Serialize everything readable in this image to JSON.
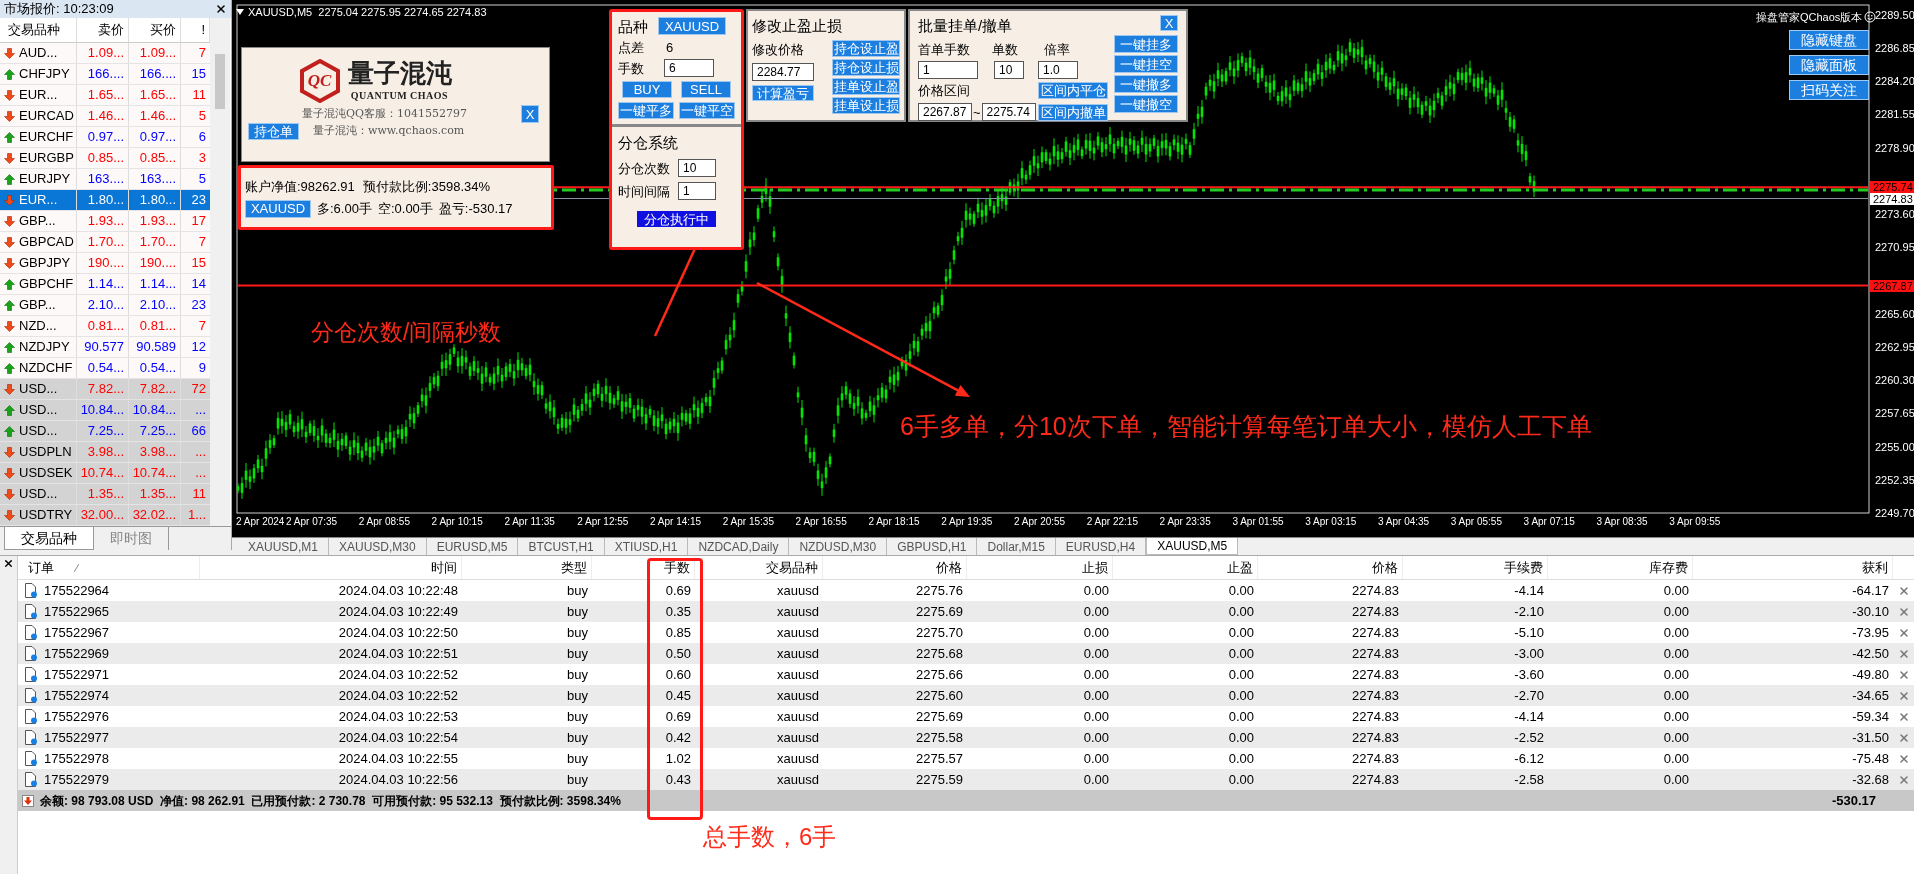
{
  "market_watch": {
    "title": "市场报价: 10:23:09",
    "columns": [
      "交易品种",
      "卖价",
      "买价",
      "!"
    ],
    "rows": [
      {
        "symbol": "AUD...",
        "bid": "1.09...",
        "ask": "1.09...",
        "spread": "7",
        "rising": false,
        "selected": false,
        "shaded": false
      },
      {
        "symbol": "CHFJPY",
        "bid": "166....",
        "ask": "166....",
        "spread": "15",
        "rising": true,
        "selected": false,
        "shaded": false
      },
      {
        "symbol": "EUR...",
        "bid": "1.65...",
        "ask": "1.65...",
        "spread": "11",
        "rising": false,
        "selected": false,
        "shaded": false
      },
      {
        "symbol": "EURCAD",
        "bid": "1.46...",
        "ask": "1.46...",
        "spread": "5",
        "rising": false,
        "selected": false,
        "shaded": false
      },
      {
        "symbol": "EURCHF",
        "bid": "0.97...",
        "ask": "0.97...",
        "spread": "6",
        "rising": true,
        "selected": false,
        "shaded": false
      },
      {
        "symbol": "EURGBP",
        "bid": "0.85...",
        "ask": "0.85...",
        "spread": "3",
        "rising": false,
        "selected": false,
        "shaded": false
      },
      {
        "symbol": "EURJPY",
        "bid": "163....",
        "ask": "163....",
        "spread": "5",
        "rising": true,
        "selected": false,
        "shaded": false
      },
      {
        "symbol": "EUR...",
        "bid": "1.80...",
        "ask": "1.80...",
        "spread": "23",
        "rising": false,
        "selected": true,
        "shaded": false
      },
      {
        "symbol": "GBP...",
        "bid": "1.93...",
        "ask": "1.93...",
        "spread": "17",
        "rising": false,
        "selected": false,
        "shaded": false
      },
      {
        "symbol": "GBPCAD",
        "bid": "1.70...",
        "ask": "1.70...",
        "spread": "7",
        "rising": false,
        "selected": false,
        "shaded": false
      },
      {
        "symbol": "GBPJPY",
        "bid": "190....",
        "ask": "190....",
        "spread": "15",
        "rising": false,
        "selected": false,
        "shaded": false
      },
      {
        "symbol": "GBPCHF",
        "bid": "1.14...",
        "ask": "1.14...",
        "spread": "14",
        "rising": true,
        "selected": false,
        "shaded": false
      },
      {
        "symbol": "GBP...",
        "bid": "2.10...",
        "ask": "2.10...",
        "spread": "23",
        "rising": true,
        "selected": false,
        "shaded": false
      },
      {
        "symbol": "NZD...",
        "bid": "0.81...",
        "ask": "0.81...",
        "spread": "7",
        "rising": false,
        "selected": false,
        "shaded": false
      },
      {
        "symbol": "NZDJPY",
        "bid": "90.577",
        "ask": "90.589",
        "spread": "12",
        "rising": true,
        "selected": false,
        "shaded": false
      },
      {
        "symbol": "NZDCHF",
        "bid": "0.54...",
        "ask": "0.54...",
        "spread": "9",
        "rising": true,
        "selected": false,
        "shaded": false
      },
      {
        "symbol": "USD...",
        "bid": "7.82...",
        "ask": "7.82...",
        "spread": "72",
        "rising": false,
        "selected": false,
        "shaded": true
      },
      {
        "symbol": "USD...",
        "bid": "10.84...",
        "ask": "10.84...",
        "spread": "...",
        "rising": true,
        "selected": false,
        "shaded": true
      },
      {
        "symbol": "USD...",
        "bid": "7.25...",
        "ask": "7.25...",
        "spread": "66",
        "rising": true,
        "selected": false,
        "shaded": true
      },
      {
        "symbol": "USDPLN",
        "bid": "3.98...",
        "ask": "3.98...",
        "spread": "...",
        "rising": false,
        "selected": false,
        "shaded": true
      },
      {
        "symbol": "USDSEK",
        "bid": "10.74...",
        "ask": "10.74...",
        "spread": "...",
        "rising": false,
        "selected": false,
        "shaded": true
      },
      {
        "symbol": "USD...",
        "bid": "1.35...",
        "ask": "1.35...",
        "spread": "11",
        "rising": false,
        "selected": false,
        "shaded": true
      },
      {
        "symbol": "USDTRY",
        "bid": "32.00...",
        "ask": "32.02...",
        "spread": "1...",
        "rising": false,
        "selected": false,
        "shaded": true
      }
    ],
    "tabs": [
      {
        "label": "交易品种",
        "selected": true
      },
      {
        "label": "即时图",
        "selected": false
      }
    ]
  },
  "chart": {
    "header": "XAUUSD,M5  2275.04 2275.95 2274.65 2274.83",
    "price_ticks": [
      "2289.50",
      "2286.85",
      "2284.20",
      "2281.55",
      "2278.90",
      "2273.60",
      "2270.95",
      "2265.60",
      "2262.95",
      "2260.30",
      "2257.65",
      "2255.00",
      "2252.35",
      "2249.70"
    ],
    "price_tags": [
      {
        "value": "2275.74",
        "kind": "line"
      },
      {
        "value": "2274.83",
        "kind": "current"
      },
      {
        "value": "2267.87",
        "kind": "line"
      }
    ],
    "time_ticks": [
      "2 Apr 2024",
      "2 Apr 07:35",
      "2 Apr 08:55",
      "2 Apr 10:15",
      "2 Apr 11:35",
      "2 Apr 12:55",
      "2 Apr 14:15",
      "2 Apr 15:35",
      "2 Apr 16:55",
      "2 Apr 18:15",
      "2 Apr 19:35",
      "2 Apr 20:55",
      "2 Apr 22:15",
      "2 Apr 23:35",
      "3 Apr 01:55",
      "3 Apr 03:15",
      "3 Apr 04:35",
      "3 Apr 05:55",
      "3 Apr 07:15",
      "3 Apr 08:35",
      "3 Apr 09:55"
    ],
    "version_label": "操盘管家QChaos版本",
    "side_buttons": [
      "隐藏键盘",
      "隐藏面板",
      "扫码关注"
    ],
    "annotations": [
      "分仓次数/间隔秒数",
      "6手多单，分10次下单，智能计算每笔订单大小，模仿人工下单"
    ]
  },
  "logo_panel": {
    "logo_mark": "QC",
    "brand": "量子混沌",
    "brand_en": "QUANTUM CHAOS",
    "support": "量子混沌QQ客服：1041552797",
    "site": "量子混沌：www.qchaos.com",
    "close": "X",
    "positions_button": "持仓单"
  },
  "account_panel": {
    "equity": "账户净值:98262.91",
    "margin_level": "预付款比例:3598.34%",
    "symbol": "XAUUSD",
    "long": "多:6.00手",
    "short": "空:0.00手",
    "pnl": "盈亏:-530.17"
  },
  "trade_panel": {
    "symbol_label": "品种",
    "symbol": "XAUUSD",
    "spread_label": "点差",
    "spread": "6",
    "lots_label": "手数",
    "lots": "6",
    "buy": "BUY",
    "sell": "SELL",
    "close_long": "一键平多",
    "close_short": "一键平空"
  },
  "split_panel": {
    "title": "分仓系统",
    "count_label": "分仓次数",
    "count": "10",
    "interval_label": "时间间隔",
    "interval": "1",
    "run": "分仓执行中"
  },
  "sltp_panel": {
    "title": "修改止盈止损",
    "price_label": "修改价格",
    "price": "2284.77",
    "calc": "计算盈亏",
    "buttons": [
      "持仓设止盈",
      "持仓设止损",
      "挂单设止盈",
      "挂单设止损"
    ]
  },
  "batch_panel": {
    "title": "批量挂单/撤单",
    "close": "X",
    "first_lots_label": "首单手数",
    "count_label": "单数",
    "multiplier_label": "倍率",
    "first_lots": "1",
    "count": "10",
    "multiplier": "1.0",
    "range_label": "价格区间",
    "range_low": "2267.87",
    "range_sep": "~",
    "range_high": "2275.74",
    "range_buttons": [
      "区间内平仓",
      "区间内撤单"
    ],
    "side_buttons": [
      "一键挂多",
      "一键挂空",
      "一键撤多",
      "一键撤空"
    ]
  },
  "chart_tabs": [
    {
      "label": "XAUUSD,M1",
      "selected": false
    },
    {
      "label": "XAUUSD,M30",
      "selected": false
    },
    {
      "label": "EURUSD,M5",
      "selected": false
    },
    {
      "label": "BTCUST,H1",
      "selected": false
    },
    {
      "label": "XTIUSD,H1",
      "selected": false
    },
    {
      "label": "NZDCAD,Daily",
      "selected": false
    },
    {
      "label": "NZDUSD,M30",
      "selected": false
    },
    {
      "label": "GBPUSD,H1",
      "selected": false
    },
    {
      "label": "Dollar,M15",
      "selected": false
    },
    {
      "label": "EURUSD,H4",
      "selected": false
    },
    {
      "label": "XAUUSD,M5",
      "selected": true
    }
  ],
  "orders": {
    "columns": [
      "订单",
      "时间",
      "类型",
      "手数",
      "交易品种",
      "价格",
      "止损",
      "止盈",
      "价格",
      "手续费",
      "库存费",
      "获利"
    ],
    "rows": [
      [
        "175522964",
        "2024.04.03 10:22:48",
        "buy",
        "0.69",
        "xauusd",
        "2275.76",
        "0.00",
        "0.00",
        "2274.83",
        "-4.14",
        "0.00",
        "-64.17"
      ],
      [
        "175522965",
        "2024.04.03 10:22:49",
        "buy",
        "0.35",
        "xauusd",
        "2275.69",
        "0.00",
        "0.00",
        "2274.83",
        "-2.10",
        "0.00",
        "-30.10"
      ],
      [
        "175522967",
        "2024.04.03 10:22:50",
        "buy",
        "0.85",
        "xauusd",
        "2275.70",
        "0.00",
        "0.00",
        "2274.83",
        "-5.10",
        "0.00",
        "-73.95"
      ],
      [
        "175522969",
        "2024.04.03 10:22:51",
        "buy",
        "0.50",
        "xauusd",
        "2275.68",
        "0.00",
        "0.00",
        "2274.83",
        "-3.00",
        "0.00",
        "-42.50"
      ],
      [
        "175522971",
        "2024.04.03 10:22:52",
        "buy",
        "0.60",
        "xauusd",
        "2275.66",
        "0.00",
        "0.00",
        "2274.83",
        "-3.60",
        "0.00",
        "-49.80"
      ],
      [
        "175522974",
        "2024.04.03 10:22:52",
        "buy",
        "0.45",
        "xauusd",
        "2275.60",
        "0.00",
        "0.00",
        "2274.83",
        "-2.70",
        "0.00",
        "-34.65"
      ],
      [
        "175522976",
        "2024.04.03 10:22:53",
        "buy",
        "0.69",
        "xauusd",
        "2275.69",
        "0.00",
        "0.00",
        "2274.83",
        "-4.14",
        "0.00",
        "-59.34"
      ],
      [
        "175522977",
        "2024.04.03 10:22:54",
        "buy",
        "0.42",
        "xauusd",
        "2275.58",
        "0.00",
        "0.00",
        "2274.83",
        "-2.52",
        "0.00",
        "-31.50"
      ],
      [
        "175522978",
        "2024.04.03 10:22:55",
        "buy",
        "1.02",
        "xauusd",
        "2275.57",
        "0.00",
        "0.00",
        "2274.83",
        "-6.12",
        "0.00",
        "-75.48"
      ],
      [
        "175522979",
        "2024.04.03 10:22:56",
        "buy",
        "0.43",
        "xauusd",
        "2275.59",
        "0.00",
        "0.00",
        "2274.83",
        "-2.58",
        "0.00",
        "-32.68"
      ]
    ],
    "summary": "余额: 98 793.08 USD  净值: 98 262.91  已用预付款: 2 730.78  可用预付款: 95 532.13  预付款比例: 3598.34%",
    "summary_profit": "-530.17",
    "note": "总手数，6手"
  }
}
